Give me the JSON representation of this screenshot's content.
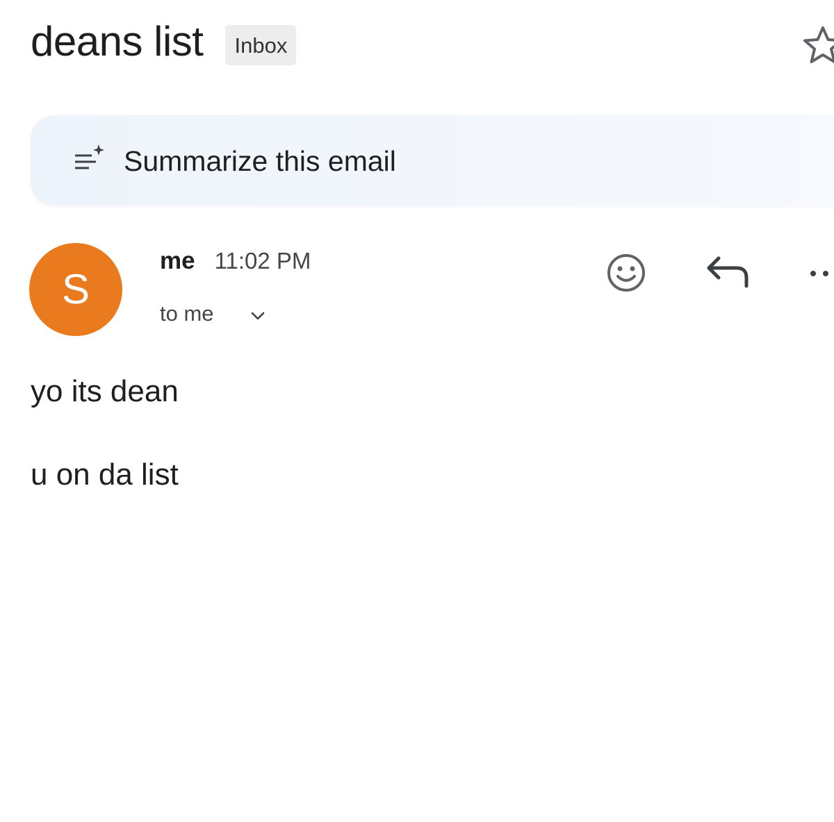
{
  "email": {
    "subject": "deans list",
    "label": "Inbox",
    "summarize_label": "Summarize this email",
    "sender": {
      "avatar_letter": "S",
      "avatar_color": "#ea7a1e",
      "name": "me",
      "time": "11:02 PM",
      "recipient": "to me"
    },
    "body": [
      "yo its dean",
      "u on da list"
    ]
  },
  "icons": {
    "star": "star-outline-icon",
    "summarize": "summarize-sparkle-icon",
    "expand": "chevron-down-icon",
    "emoji": "add-reaction-icon",
    "reply": "reply-icon",
    "more": "more-options-icon"
  }
}
